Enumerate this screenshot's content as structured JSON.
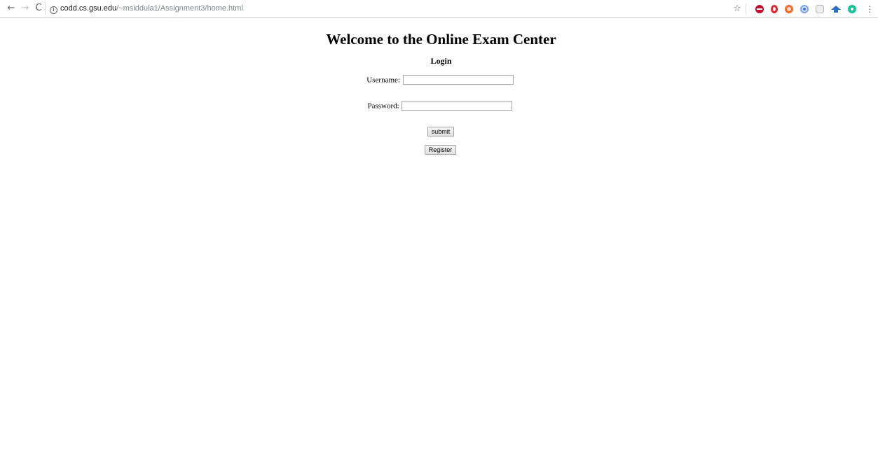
{
  "browser": {
    "url_host": "codd.cs.gsu.edu",
    "url_path": "/~msiddula1/Assignment3/home.html",
    "icons": {
      "back": "back-arrow-icon",
      "forward": "forward-arrow-icon",
      "reload": "reload-icon",
      "info": "info-icon",
      "bookmark": "star-icon",
      "menu": "kebab-menu-icon"
    },
    "extensions": [
      "adblock-icon",
      "opera-icon",
      "orange-extension-icon",
      "blue-extension-icon",
      "grey-extension-icon",
      "graduation-cap-icon",
      "grammarly-icon"
    ]
  },
  "page": {
    "title": "Welcome to the Online Exam Center",
    "login_heading": "Login",
    "username_label": "Username:",
    "username_value": "",
    "password_label": "Password:",
    "password_value": "",
    "submit_label": "submit",
    "register_label": "Register"
  },
  "colors": {
    "background": "#ffffff",
    "text": "#000000",
    "url_path": "#80868b"
  }
}
